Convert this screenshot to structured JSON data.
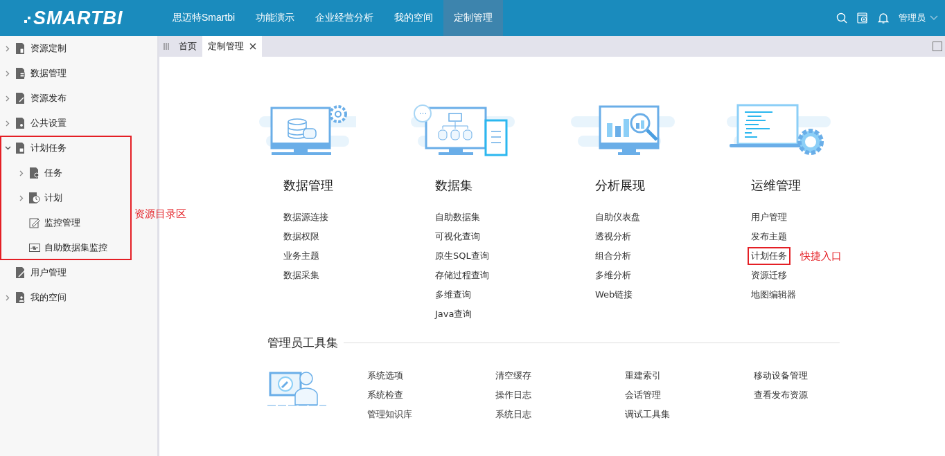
{
  "header": {
    "logo": "SMARTBI",
    "nav": [
      {
        "label": "思迈特Smartbi",
        "selected": false
      },
      {
        "label": "功能演示",
        "selected": false
      },
      {
        "label": "企业经营分析",
        "selected": false
      },
      {
        "label": "我的空间",
        "selected": false
      },
      {
        "label": "定制管理",
        "selected": true
      }
    ],
    "user": "管理员"
  },
  "tabs": [
    {
      "label": "首页",
      "selected": false,
      "closable": false
    },
    {
      "label": "定制管理",
      "selected": true,
      "closable": true
    }
  ],
  "sidebar": {
    "items": [
      {
        "label": "资源定制",
        "kind": "folder",
        "expanded": false,
        "highlighted": false
      },
      {
        "label": "数据管理",
        "kind": "folder",
        "expanded": false,
        "highlighted": false
      },
      {
        "label": "资源发布",
        "kind": "folder",
        "expanded": false,
        "highlighted": false
      },
      {
        "label": "公共设置",
        "kind": "folder",
        "expanded": false,
        "highlighted": false
      },
      {
        "label": "计划任务",
        "kind": "folder",
        "expanded": true,
        "highlighted": true,
        "callout": "资源目录区",
        "children": [
          {
            "label": "任务",
            "kind": "folder",
            "expanded": false
          },
          {
            "label": "计划",
            "kind": "folder",
            "expanded": false
          },
          {
            "label": "监控管理",
            "kind": "leaf"
          },
          {
            "label": "自助数据集监控",
            "kind": "leaf"
          }
        ]
      },
      {
        "label": "用户管理",
        "kind": "leaf",
        "highlighted": false
      },
      {
        "label": "我的空间",
        "kind": "folder",
        "expanded": false,
        "highlighted": false
      }
    ]
  },
  "cards": [
    {
      "title": "数据管理",
      "links": [
        {
          "label": "数据源连接",
          "highlighted": false
        },
        {
          "label": "数据权限",
          "highlighted": false
        },
        {
          "label": "业务主题",
          "highlighted": false
        },
        {
          "label": "数据采集",
          "highlighted": false
        }
      ]
    },
    {
      "title": "数据集",
      "links": [
        {
          "label": "自助数据集",
          "highlighted": false
        },
        {
          "label": "可视化查询",
          "highlighted": false
        },
        {
          "label": "原生SQL查询",
          "highlighted": false
        },
        {
          "label": "存储过程查询",
          "highlighted": false
        },
        {
          "label": "多维查询",
          "highlighted": false
        },
        {
          "label": "Java查询",
          "highlighted": false
        }
      ]
    },
    {
      "title": "分析展现",
      "links": [
        {
          "label": "自助仪表盘",
          "highlighted": false
        },
        {
          "label": "透视分析",
          "highlighted": false
        },
        {
          "label": "组合分析",
          "highlighted": false
        },
        {
          "label": "多维分析",
          "highlighted": false
        },
        {
          "label": "Web链接",
          "highlighted": false
        }
      ]
    },
    {
      "title": "运维管理",
      "links": [
        {
          "label": "用户管理",
          "highlighted": false
        },
        {
          "label": "发布主题",
          "highlighted": false
        },
        {
          "label": "计划任务",
          "highlighted": true,
          "callout": "快捷入口"
        },
        {
          "label": "资源迁移",
          "highlighted": false
        },
        {
          "label": "地图编辑器",
          "highlighted": false
        }
      ]
    }
  ],
  "admin_tools": {
    "title": "管理员工具集",
    "columns": [
      [
        "系统选项",
        "系统检查",
        "管理知识库"
      ],
      [
        "清空缓存",
        "操作日志",
        "系统日志"
      ],
      [
        "重建索引",
        "会话管理",
        "调试工具集"
      ],
      [
        "移动设备管理",
        "查看发布资源"
      ]
    ]
  }
}
